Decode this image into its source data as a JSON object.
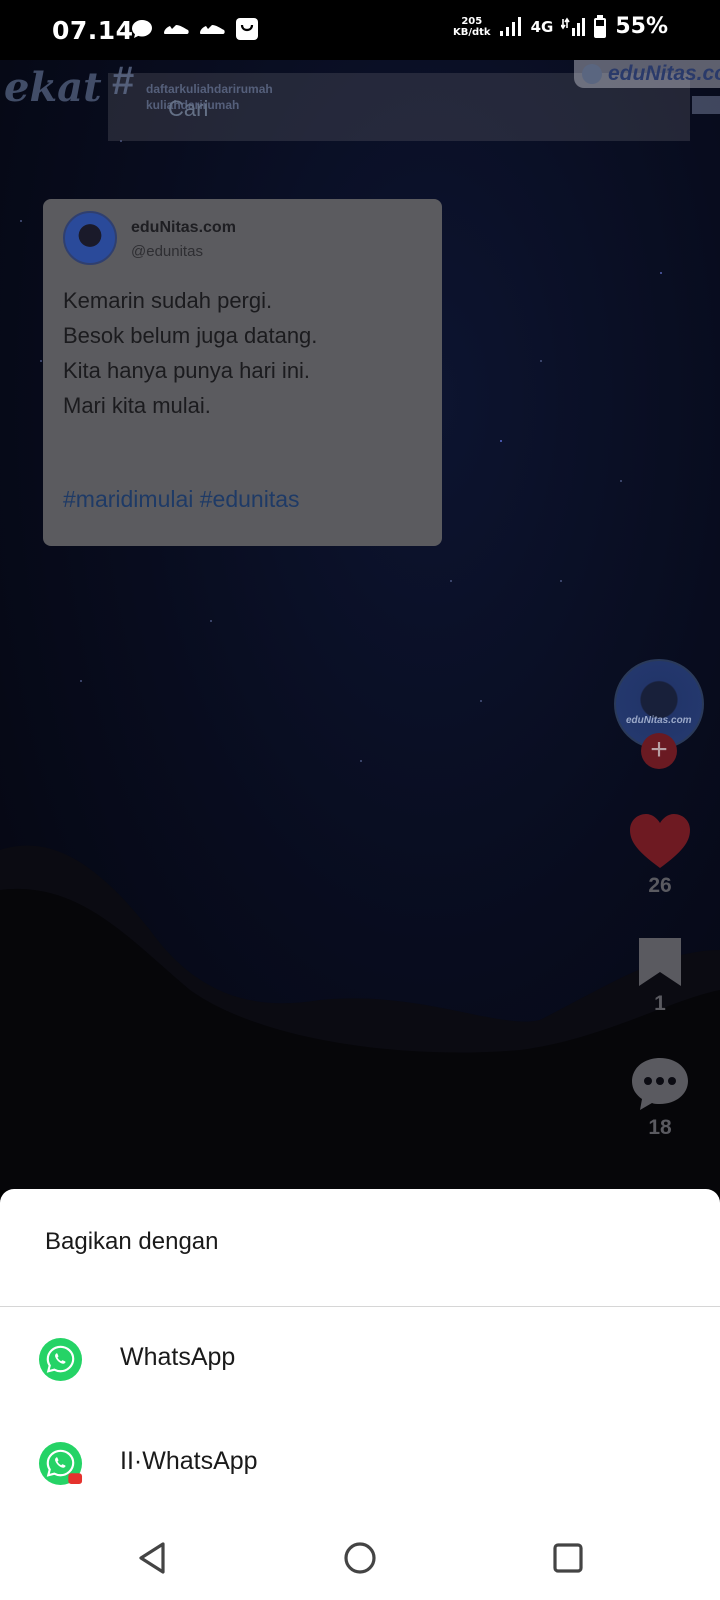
{
  "status_bar": {
    "time": "07.14",
    "speed_value": "205",
    "speed_unit": "KB/dtk",
    "network": "4G",
    "battery": "55%"
  },
  "video": {
    "search_placeholder": "Cari",
    "overlay_tag_line1": "daftarkuliahdarirumah",
    "overlay_tag_line2": "kuliahdarirumah",
    "brand_badge": "eduNitas.co"
  },
  "post": {
    "name": "eduNitas.com",
    "handle": "@edunitas",
    "lines": [
      "Kemarin sudah pergi.",
      "Besok belum juga datang.",
      "Kita hanya punya hari ini.",
      "Mari kita mulai."
    ],
    "hashtags": "#maridimulai #edunitas"
  },
  "actions": {
    "creator_brand": "eduNitas.com",
    "likes": "26",
    "bookmarks": "1",
    "comments": "18"
  },
  "share_sheet": {
    "title": "Bagikan dengan",
    "apps": [
      {
        "label": "WhatsApp",
        "icon": "whatsapp-icon"
      },
      {
        "label": "II·WhatsApp",
        "icon": "whatsapp-dual-icon"
      }
    ]
  },
  "colors": {
    "whatsapp_green": "#25D366",
    "like_red": "#6e1a22",
    "sheet_bg": "#ffffff"
  }
}
